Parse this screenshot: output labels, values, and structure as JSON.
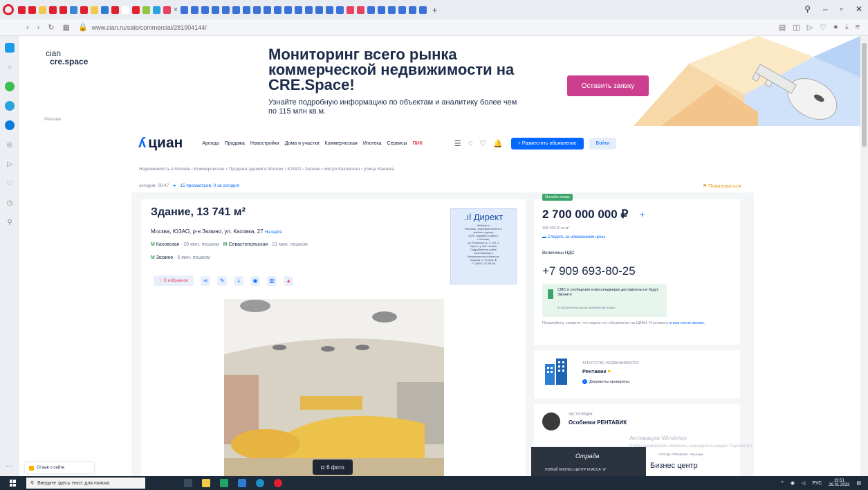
{
  "browser": {
    "url": "www.cian.ru/sale/commercial/281904144/",
    "tab_close": "×",
    "tab_add": "+",
    "colors": {
      "opera_red": "#e0212d",
      "tab_bg": "#e9ecf3"
    }
  },
  "banner": {
    "logo_line1": "cian",
    "logo_line2": "cre.space",
    "ad_label": "Реклама",
    "title": "Мониторинг всего рынка коммерческой недвижимости на CRE.Space!",
    "subtitle": "Узнайте подробную информацию по объектам и аналитику более чем по 115 млн кв.м.",
    "button": "Оставить заявку",
    "button_color": "#cc3f8e"
  },
  "header": {
    "logo": "циан",
    "nav": [
      "Аренда",
      "Продажа",
      "Новостройки",
      "Дома и участки",
      "Коммерческая",
      "Ипотека",
      "Сервисы"
    ],
    "nav_special": "ПИК",
    "post_button": "+ Разместить объявление",
    "login_button": "Войти",
    "accent": "#0468ff"
  },
  "breadcrumbs": "Недвижимость в Москве › Коммерческая › Продажа зданий в Москве › ЮЗАО › Зюзино › метро Каховская › улица Каховка",
  "meta": {
    "updated": "сегодня, 00:47",
    "views": "15 просмотров, 0 за сегодня",
    "complain": "Пожаловаться"
  },
  "listing": {
    "title": "Здание, 13 741 м²",
    "address": "Москва, ЮЗАО, р-н Зюзино, ул. Каховка, 27",
    "map_link": "На карте",
    "metro": [
      {
        "name": "Каховская",
        "time": "· 20 мин. пешком"
      },
      {
        "name": "Севастопольская",
        "time": "· 21 мин. пешком"
      },
      {
        "name": "Зюзино",
        "time": "· 5 мин. пешком"
      }
    ],
    "favorite": "В избранное",
    "photo_count": "6 фото"
  },
  "direct_ad": {
    "logo": "Директ",
    "lines": [
      "kitaiskiy.ru",
      "Реклама. Тканевые мебель и",
      "мебель и декор",
      "ООО «Дизайн Сервис»",
      "г. Москва,",
      "ул. Большая, д. 1, стр. 2",
      "Купить у нас онлайн",
      "Подробнее на сайте",
      "www.kitaiskiy.ru",
      "Минимальная стоимость",
      "покупки от 70 млн. ₽",
      "+7 (495) 737-89-66"
    ]
  },
  "price_card": {
    "online_badge": "Онлайн-показ",
    "price": "2 700 000 000 ₽",
    "price_per_m2": "196 492 ₽ за м²",
    "follow_price": "Следить за изменением цены",
    "vat": "Включены НДС",
    "phone": "+7 909 693-80-25",
    "sms_title": "СМС и сообщения в мессенджерах доставлены не будут. Звоните",
    "sms_sub": "В объявлении указан временный номер",
    "note": "Пожалуйста, скажите, что нашли это объявление на ЦИАН. И оставьте",
    "note_link": "отзыв после звонка."
  },
  "agency": {
    "type": "АГЕНТСТВО НЕДВИЖИМОСТИ",
    "name": "Рентавик",
    "docs": "Документы проверены"
  },
  "owner": {
    "type": "ЗАСТРОЙЩИК",
    "name": "Особняки РЕНТАВИК"
  },
  "popups": {
    "dark_logo": "Отрада",
    "dark_sub": "НОВЫЙ БИЗНЕС-ЦЕНТР КЛАССА \"А\"",
    "white_top": "ОТРАДА ПРЕМИУМ · Реклама",
    "white_title": "Бизнес центр"
  },
  "windows": {
    "activate_title": "Активация Windows",
    "activate_sub": "Чтобы активировать Windows, перейдите в раздел \"Параметры\".",
    "search_placeholder": "Введите здесь текст для поиска",
    "lang": "РУС",
    "time": "15:51",
    "date": "26.01.2023"
  },
  "feedback": "Отзыв о сайте"
}
